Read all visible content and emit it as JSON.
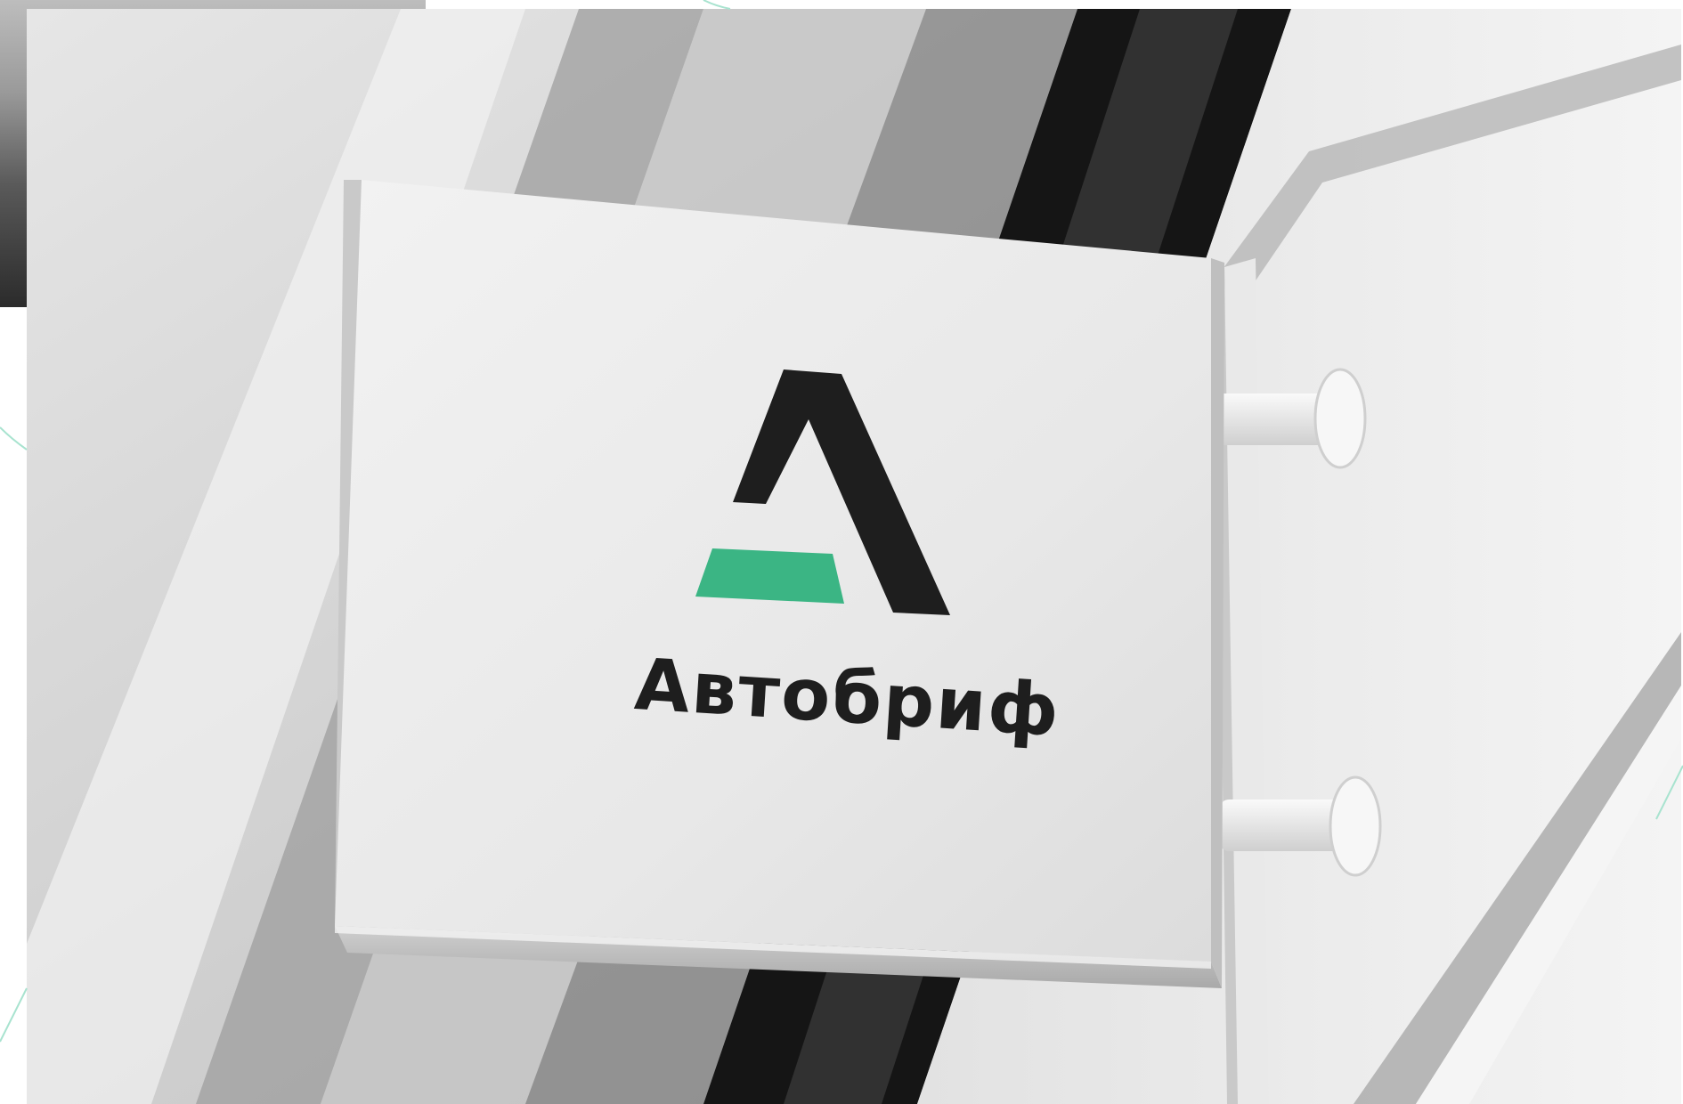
{
  "brand": {
    "name": "Автобриф",
    "accent_color": "#3bb584",
    "ink_color": "#1e1e1e"
  },
  "scene": {
    "photo_style": "grayscale",
    "decorative_line_color": "#a8e3cf"
  }
}
